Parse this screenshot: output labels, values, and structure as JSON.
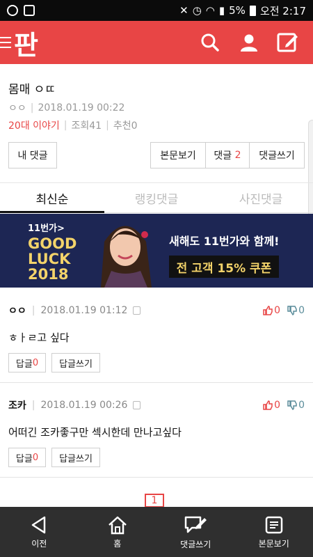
{
  "status_bar": {
    "battery": "5%",
    "time": "오전 2:17"
  },
  "header": {
    "logo": "판",
    "icons": [
      "menu-icon",
      "search-icon",
      "user-icon",
      "compose-icon"
    ]
  },
  "post": {
    "title": "몸매 ㅇㄸ",
    "author": "ㅇㅇ",
    "date": "2018.01.19 00:22",
    "category": "20대 이야기",
    "views": "조회41",
    "recommend": "추천0"
  },
  "buttons": {
    "my_comments": "내 댓글",
    "view_post": "본문보기",
    "comments_label": "댓글",
    "comments_count": "2",
    "write_comment": "댓글쓰기"
  },
  "tabs": [
    {
      "label": "최신순",
      "active": true
    },
    {
      "label": "랭킹댓글",
      "active": false
    },
    {
      "label": "사진댓글",
      "active": false
    }
  ],
  "banner": {
    "brand": "11번가>",
    "luck_line1": "GOOD",
    "luck_line2": "LUCK",
    "luck_line3": "2018",
    "copy": "새해도 11번가와 함께!",
    "coupon": "전 고객 15% 쿠폰"
  },
  "comments": [
    {
      "author": "ㅇㅇ",
      "date": "2018.01.19 01:12",
      "up": "0",
      "down": "0",
      "text": "ㅎㅏㄹ고 싶다",
      "reply_label": "답글",
      "reply_count": "0",
      "write_label": "답글쓰기"
    },
    {
      "author": "조카",
      "date": "2018.01.19 00:26",
      "up": "0",
      "down": "0",
      "text": "어떠긴 조카좋구만 섹시한데 만나고싶다",
      "reply_label": "답글",
      "reply_count": "0",
      "write_label": "답글쓰기"
    }
  ],
  "pagination": {
    "current": "1"
  },
  "bottom_nav": [
    {
      "label": "이전",
      "icon": "back-icon"
    },
    {
      "label": "홈",
      "icon": "home-icon"
    },
    {
      "label": "댓글쓰기",
      "icon": "comment-write-icon"
    },
    {
      "label": "본문보기",
      "icon": "document-icon"
    }
  ],
  "colors": {
    "accent": "#e84545",
    "banner": "#1d2654",
    "bottom_bar": "#2f2f2f"
  }
}
